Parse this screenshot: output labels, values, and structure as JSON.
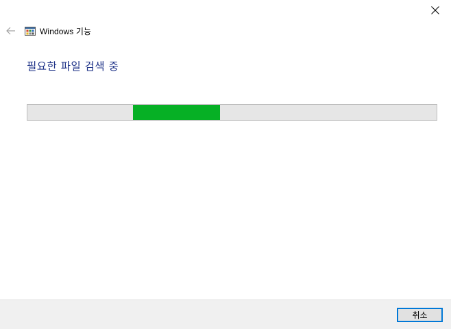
{
  "window": {
    "title": "Windows 기능",
    "close_icon": "close-icon",
    "back_icon": "back-arrow-icon",
    "app_icon": "windows-features-icon"
  },
  "main": {
    "heading": "필요한 파일 검색 중",
    "progress": {
      "state": "indeterminate",
      "fill_color": "#06b025",
      "track_color": "#e6e6e6"
    }
  },
  "footer": {
    "cancel_label": "취소"
  },
  "colors": {
    "heading": "#1e3287",
    "accent": "#0078d7",
    "footer_bg": "#f0f0f0"
  }
}
